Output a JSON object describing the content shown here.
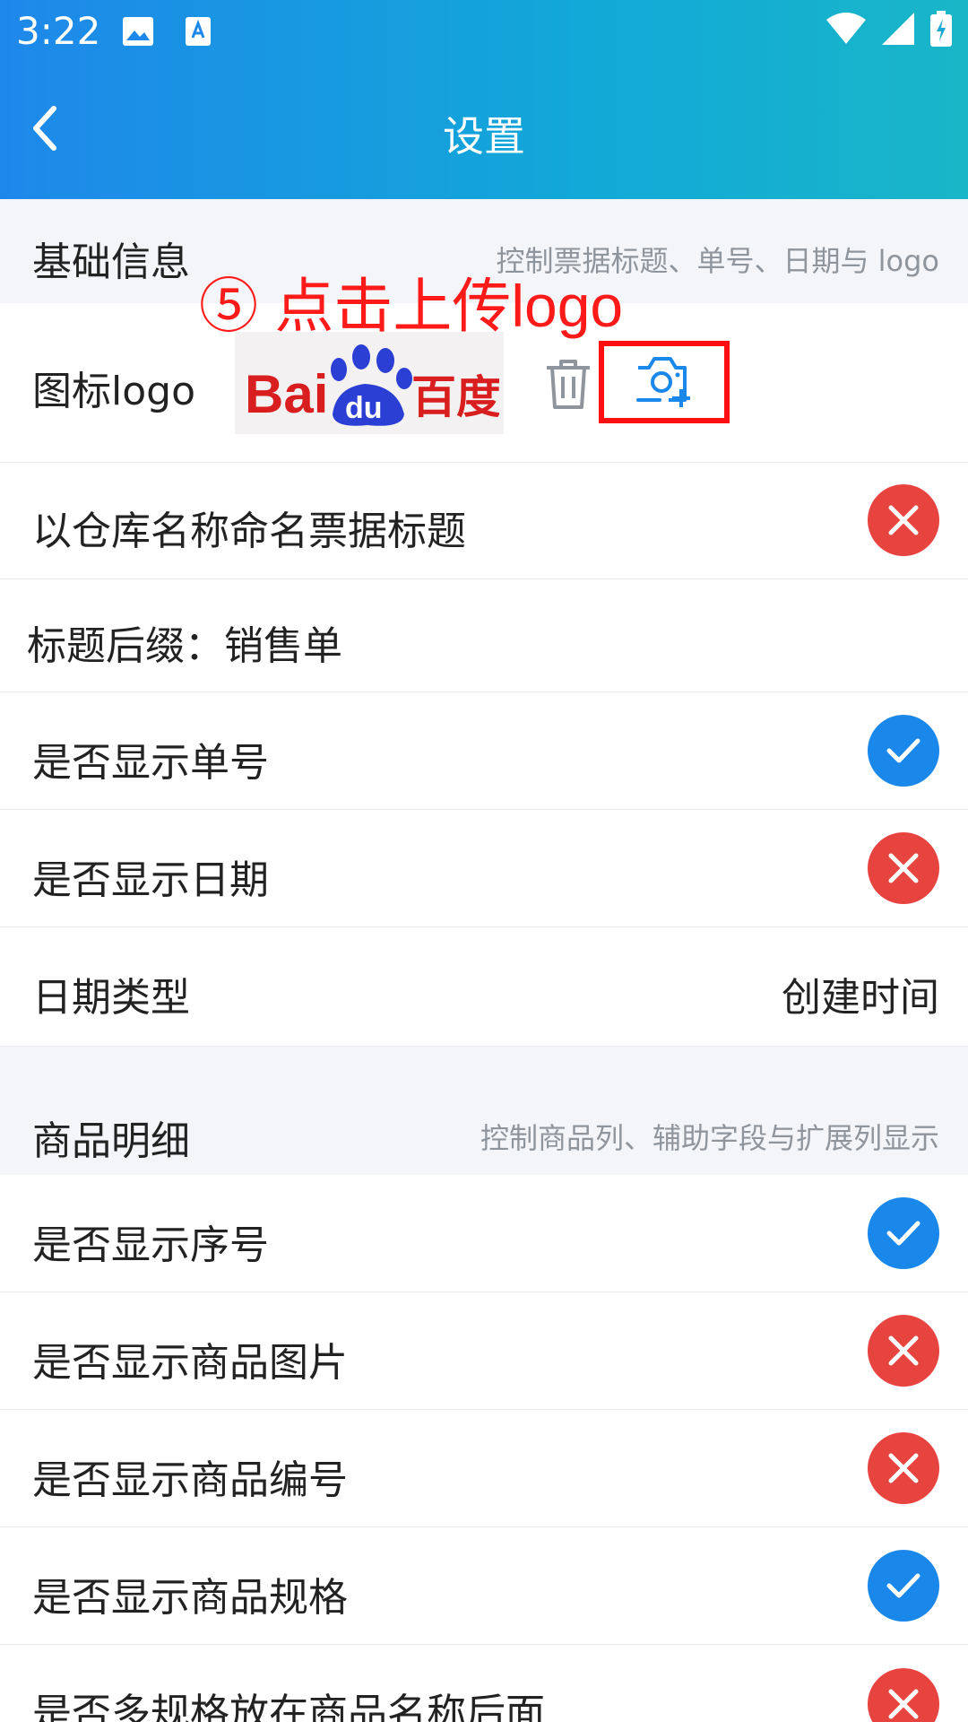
{
  "status_bar": {
    "time": "3:22"
  },
  "nav": {
    "title": "设置"
  },
  "basic_section": {
    "title": "基础信息",
    "description": "控制票据标题、单号、日期与 logo"
  },
  "logo_row": {
    "label": "图标logo",
    "logo_text": "Bai百度",
    "logo_brand": "Baidu"
  },
  "annotation": {
    "text": "⑤ 点击上传logo"
  },
  "rows_basic": [
    {
      "label": "以仓库名称命名票据标题",
      "state": "off"
    },
    {
      "label": "标题后缀：销售单"
    },
    {
      "label": "是否显示单号",
      "state": "on"
    },
    {
      "label": "是否显示日期",
      "state": "off"
    },
    {
      "label": "日期类型",
      "value": "创建时间"
    }
  ],
  "goods_section": {
    "title": "商品明细",
    "description": "控制商品列、辅助字段与扩展列显示"
  },
  "rows_goods": [
    {
      "label": "是否显示序号",
      "state": "on"
    },
    {
      "label": "是否显示商品图片",
      "state": "off"
    },
    {
      "label": "是否显示商品编号",
      "state": "off"
    },
    {
      "label": "是否显示商品规格",
      "state": "on"
    },
    {
      "label": "是否多规格放在商品名称后面",
      "state": "off"
    }
  ],
  "colors": {
    "accent": "#1a87ea",
    "off": "#e8443f",
    "annotation": "#ff1a1a"
  }
}
